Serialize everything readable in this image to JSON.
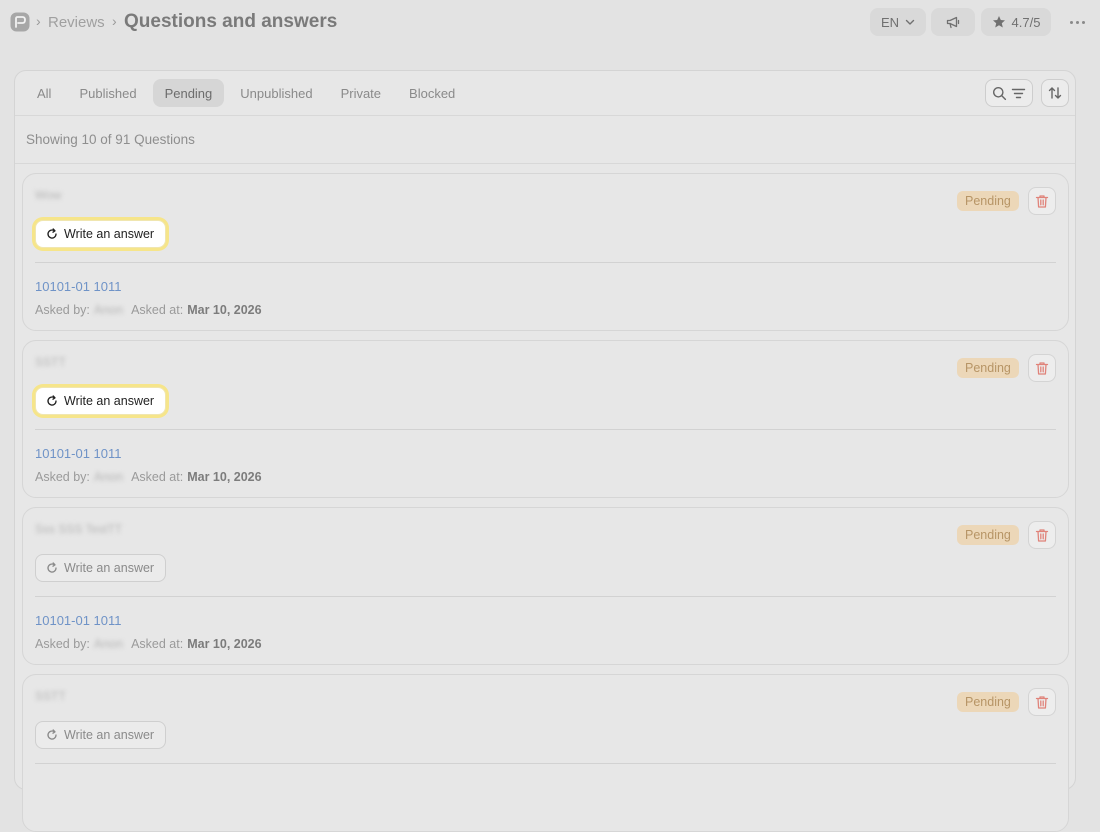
{
  "header": {
    "breadcrumb_parent": "Reviews",
    "title": "Questions and answers",
    "language": "EN",
    "rating": "4.7/5"
  },
  "tabs": [
    "All",
    "Published",
    "Pending",
    "Unpublished",
    "Private",
    "Blocked"
  ],
  "active_tab": "Pending",
  "showing_text": "Showing 10 of 91 Questions",
  "questions": [
    {
      "text": "Wow",
      "status": "Pending",
      "answer_label": "Write an answer",
      "product": "10101-01 1011",
      "asked_by_label": "Asked by:",
      "asker": "Anon",
      "asked_at_label": "Asked at:",
      "asked_at": "Mar 10, 2026"
    },
    {
      "text": "SSTT",
      "status": "Pending",
      "answer_label": "Write an answer",
      "product": "10101-01 1011",
      "asked_by_label": "Asked by:",
      "asker": "Anon",
      "asked_at_label": "Asked at:",
      "asked_at": "Mar 10, 2026"
    },
    {
      "text": "Sss SSS TestTT",
      "status": "Pending",
      "answer_label": "Write an answer",
      "product": "10101-01 1011",
      "asked_by_label": "Asked by:",
      "asker": "Anon",
      "asked_at_label": "Asked at:",
      "asked_at": "Mar 10, 2026"
    },
    {
      "text": "SSTT",
      "status": "Pending",
      "answer_label": "Write an answer",
      "product": "",
      "asked_by_label": "",
      "asker": "",
      "asked_at_label": "",
      "asked_at": ""
    }
  ],
  "colors": {
    "background": "#e3e3e3",
    "pending_badge_bg": "#ecd7b8",
    "pending_badge_text": "#b79566",
    "link": "#6f93c7",
    "highlight_ring": "#f6e58a",
    "delete_icon": "#e0837a"
  },
  "icons": {
    "logo": "chat-bubble-logo-icon",
    "language_chevron": "chevron-down-icon",
    "announce": "megaphone-icon",
    "rating": "star-icon",
    "more": "more-horizontal-icon",
    "search": "search-icon",
    "filter": "filter-icon",
    "sort": "sort-arrows-icon",
    "delete": "trash-icon",
    "answer": "refresh-icon"
  }
}
